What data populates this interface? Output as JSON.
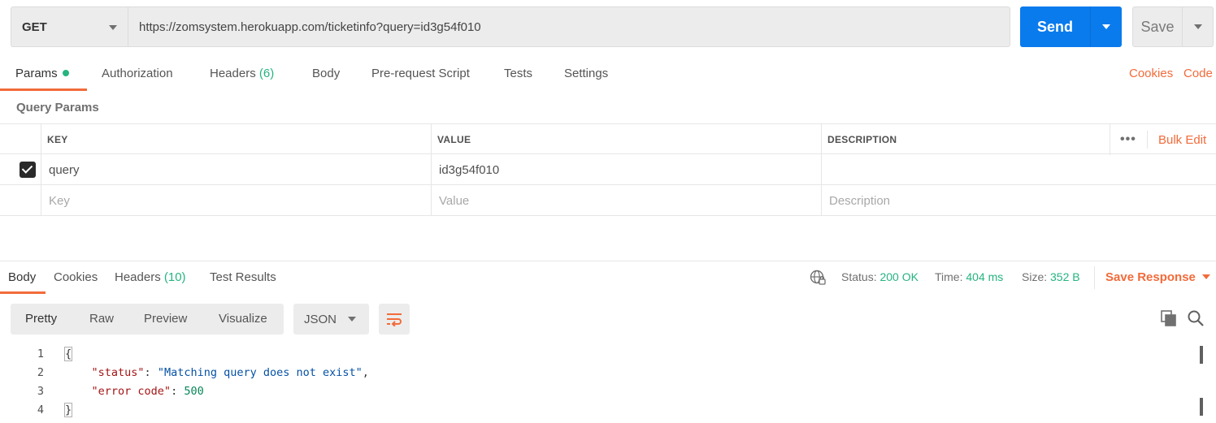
{
  "request": {
    "method": "GET",
    "url": "https://zomsystem.herokuapp.com/ticketinfo?query=id3g54f010",
    "send_label": "Send",
    "save_label": "Save"
  },
  "request_tabs": {
    "params": "Params",
    "authorization": "Authorization",
    "headers": "Headers",
    "headers_count": "(6)",
    "body": "Body",
    "pre_request": "Pre-request Script",
    "tests": "Tests",
    "settings": "Settings",
    "cookies": "Cookies",
    "code": "Code"
  },
  "query_params": {
    "title": "Query Params",
    "columns": {
      "key": "KEY",
      "value": "VALUE",
      "description": "DESCRIPTION"
    },
    "more": "•••",
    "bulk_edit": "Bulk Edit",
    "rows": [
      {
        "checked": true,
        "key": "query",
        "value": "id3g54f010",
        "description": ""
      }
    ],
    "placeholders": {
      "key": "Key",
      "value": "Value",
      "description": "Description"
    }
  },
  "response_tabs": {
    "body": "Body",
    "cookies": "Cookies",
    "headers": "Headers",
    "headers_count": "(10)",
    "test_results": "Test Results"
  },
  "response_status": {
    "status_label": "Status:",
    "status_value": "200 OK",
    "time_label": "Time:",
    "time_value": "404 ms",
    "size_label": "Size:",
    "size_value": "352 B",
    "save_response": "Save Response"
  },
  "response_view": {
    "modes": [
      "Pretty",
      "Raw",
      "Preview",
      "Visualize"
    ],
    "active_mode": "Pretty",
    "format": "JSON"
  },
  "response_body": {
    "lines": [
      {
        "num": "1",
        "open": "{"
      },
      {
        "num": "2",
        "key": "\"status\"",
        "colon": ": ",
        "str": "\"Matching query does not exist\"",
        "tail": ","
      },
      {
        "num": "3",
        "key": "\"error code\"",
        "colon": ": ",
        "num_val": "500"
      },
      {
        "num": "4",
        "close": "}"
      }
    ]
  },
  "colors": {
    "accent": "#f26b3a",
    "primary": "#097bed",
    "success": "#26b47f"
  }
}
